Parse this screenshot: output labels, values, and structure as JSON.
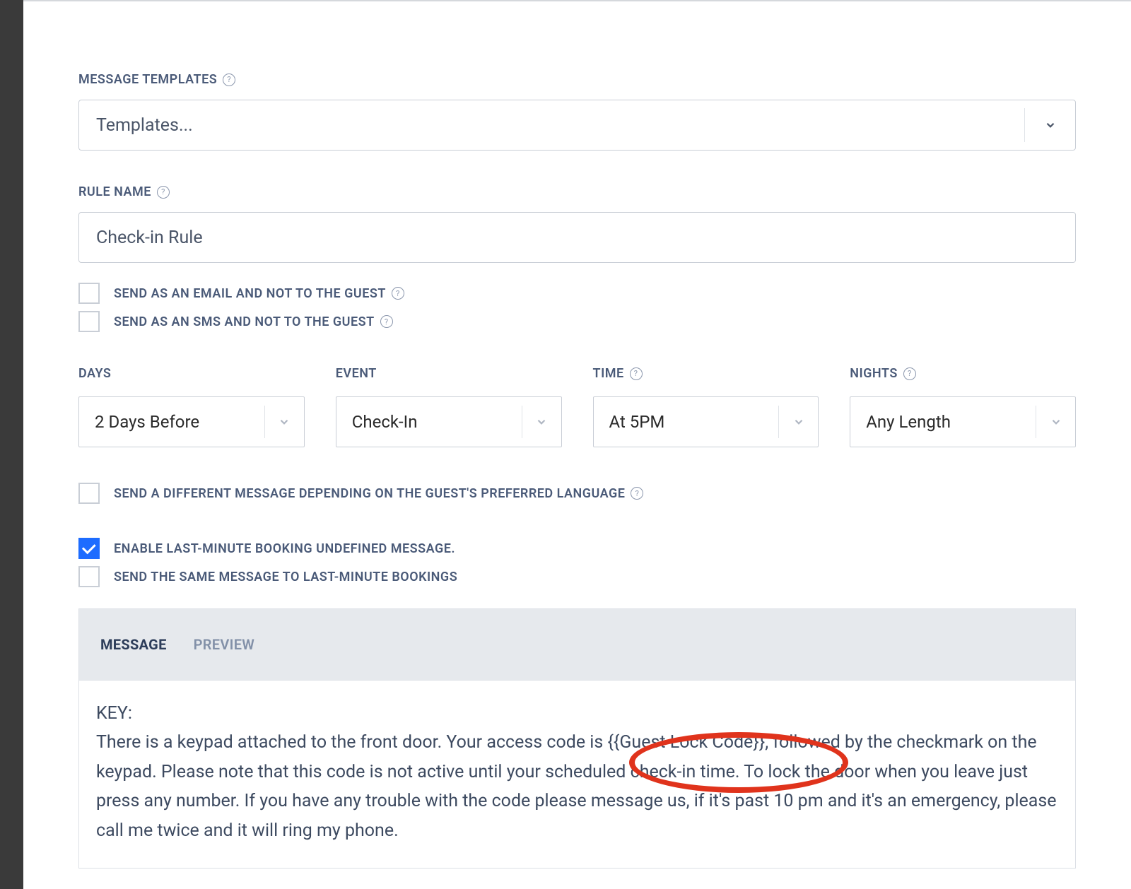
{
  "message_templates": {
    "label": "MESSAGE TEMPLATES",
    "placeholder": "Templates..."
  },
  "rule_name": {
    "label": "RULE NAME",
    "value": "Check-in Rule"
  },
  "checkboxes": {
    "send_email": {
      "label": "SEND AS AN EMAIL AND NOT TO THE GUEST",
      "checked": false
    },
    "send_sms": {
      "label": "SEND AS AN SMS AND NOT TO THE GUEST",
      "checked": false
    },
    "diff_lang": {
      "label": "SEND A DIFFERENT MESSAGE DEPENDING ON THE GUEST'S PREFERRED LANGUAGE",
      "checked": false
    },
    "last_minute": {
      "label": "ENABLE LAST-MINUTE BOOKING UNDEFINED MESSAGE.",
      "checked": true
    },
    "same_last_minute": {
      "label": "SEND THE SAME MESSAGE TO LAST-MINUTE BOOKINGS",
      "checked": false
    }
  },
  "dropdowns": {
    "days": {
      "label": "DAYS",
      "value": "2 Days Before"
    },
    "event": {
      "label": "EVENT",
      "value": "Check-In"
    },
    "time": {
      "label": "TIME",
      "value": "At 5PM"
    },
    "nights": {
      "label": "NIGHTS",
      "value": "Any Length"
    }
  },
  "tabs": {
    "message": "MESSAGE",
    "preview": "PREVIEW"
  },
  "message": {
    "key_label": "KEY:",
    "body": "There is a keypad attached to the front door. Your access code is {{Guest Lock Code}}, followed by the checkmark on the keypad. Please note that this code is not active until your scheduled check-in time. To lock the door when you leave just press any number.  If you have any trouble with the code please message us, if it's past 10 pm and it's an emergency, please call me twice and it will ring my phone."
  }
}
